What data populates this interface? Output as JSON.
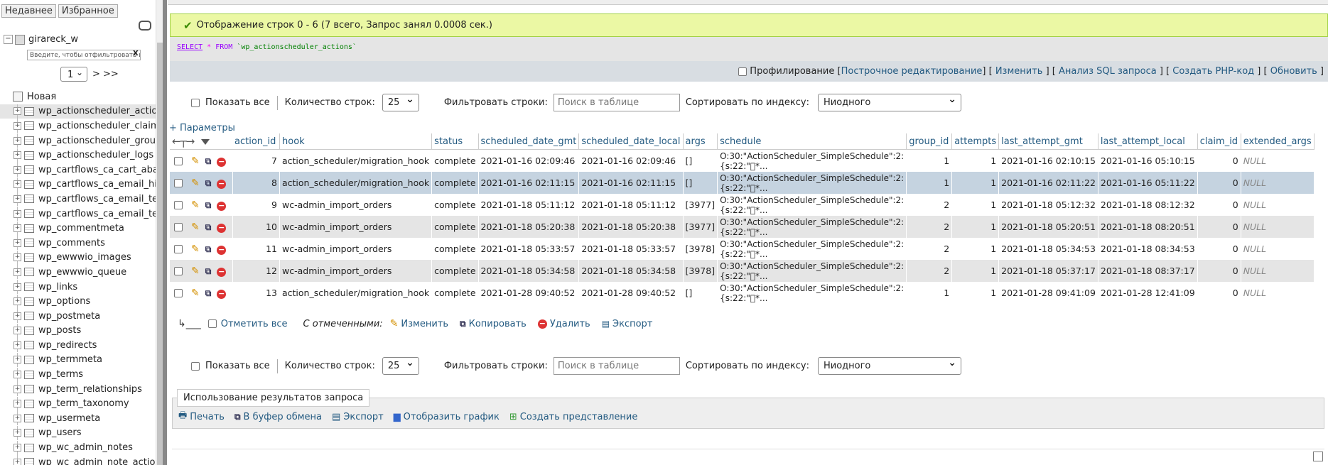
{
  "nav": {
    "tabs": [
      "Недавнее",
      "Избранное"
    ],
    "db_name": "girareck_w",
    "filter_placeholder": "Введите, чтобы отфильтровать и",
    "filter_clear": "X",
    "page": "1",
    "page_next": "> >>",
    "new_label": "Новая",
    "tables": [
      "wp_actionscheduler_actions",
      "wp_actionscheduler_claims",
      "wp_actionscheduler_groups",
      "wp_actionscheduler_logs",
      "wp_cartflows_ca_cart_abandonment",
      "wp_cartflows_ca_email_history",
      "wp_cartflows_ca_email_templates",
      "wp_cartflows_ca_email_templates_meta",
      "wp_commentmeta",
      "wp_comments",
      "wp_ewwwio_images",
      "wp_ewwwio_queue",
      "wp_links",
      "wp_options",
      "wp_postmeta",
      "wp_posts",
      "wp_redirects",
      "wp_termmeta",
      "wp_terms",
      "wp_term_relationships",
      "wp_term_taxonomy",
      "wp_usermeta",
      "wp_users",
      "wp_wc_admin_notes",
      "wp_wc_admin_note_actions"
    ]
  },
  "result": {
    "message": "Отображение строк 0 - 6 (7 всего, Запрос занял 0.0008 сек.)",
    "sql": {
      "select": "SELECT",
      "star": "*",
      "from": "FROM",
      "table": "`wp_actionscheduler_actions`"
    }
  },
  "links": {
    "profiling": "Профилирование",
    "inline_edit": "Построчное редактирование",
    "edit": "Изменить",
    "explain": "Анализ SQL запроса",
    "php": "Создать PHP-код",
    "refresh": "Обновить"
  },
  "controls": {
    "show_all": "Показать все",
    "row_count_label": "Количество строк:",
    "row_count": "25",
    "filter_label": "Фильтровать строки:",
    "filter_placeholder": "Поиск в таблице",
    "sort_label": "Сортировать по индексу:",
    "sort_value": "Ниодного"
  },
  "params_label": "+ Параметры",
  "table": {
    "columns": [
      "action_id",
      "hook",
      "status",
      "scheduled_date_gmt",
      "scheduled_date_local",
      "args",
      "schedule",
      "group_id",
      "attempts",
      "last_attempt_gmt",
      "last_attempt_local",
      "claim_id",
      "extended_args"
    ],
    "rows": [
      [
        "7",
        "action_scheduler/migration_hook",
        "complete",
        "2021-01-16 02:09:46",
        "2021-01-16 02:09:46",
        "[]",
        "O:30:\"ActionScheduler_SimpleSchedule\":2:{s:22:\"\u0000*...",
        "1",
        "1",
        "2021-01-16 02:10:15",
        "2021-01-16 05:10:15",
        "0",
        "NULL"
      ],
      [
        "8",
        "action_scheduler/migration_hook",
        "complete",
        "2021-01-16 02:11:15",
        "2021-01-16 02:11:15",
        "[]",
        "O:30:\"ActionScheduler_SimpleSchedule\":2:{s:22:\"\u0000*...",
        "1",
        "1",
        "2021-01-16 02:11:22",
        "2021-01-16 05:11:22",
        "0",
        "NULL"
      ],
      [
        "9",
        "wc-admin_import_orders",
        "complete",
        "2021-01-18 05:11:12",
        "2021-01-18 05:11:12",
        "[3977]",
        "O:30:\"ActionScheduler_SimpleSchedule\":2:{s:22:\"\u0000*...",
        "2",
        "1",
        "2021-01-18 05:12:32",
        "2021-01-18 08:12:32",
        "0",
        "NULL"
      ],
      [
        "10",
        "wc-admin_import_orders",
        "complete",
        "2021-01-18 05:20:38",
        "2021-01-18 05:20:38",
        "[3977]",
        "O:30:\"ActionScheduler_SimpleSchedule\":2:{s:22:\"\u0000*...",
        "2",
        "1",
        "2021-01-18 05:20:51",
        "2021-01-18 08:20:51",
        "0",
        "NULL"
      ],
      [
        "11",
        "wc-admin_import_orders",
        "complete",
        "2021-01-18 05:33:57",
        "2021-01-18 05:33:57",
        "[3978]",
        "O:30:\"ActionScheduler_SimpleSchedule\":2:{s:22:\"\u0000*...",
        "2",
        "1",
        "2021-01-18 05:34:53",
        "2021-01-18 08:34:53",
        "0",
        "NULL"
      ],
      [
        "12",
        "wc-admin_import_orders",
        "complete",
        "2021-01-18 05:34:58",
        "2021-01-18 05:34:58",
        "[3978]",
        "O:30:\"ActionScheduler_SimpleSchedule\":2:{s:22:\"\u0000*...",
        "2",
        "1",
        "2021-01-18 05:37:17",
        "2021-01-18 08:37:17",
        "0",
        "NULL"
      ],
      [
        "13",
        "action_scheduler/migration_hook",
        "complete",
        "2021-01-28 09:40:52",
        "2021-01-28 09:40:52",
        "[]",
        "O:30:\"ActionScheduler_SimpleSchedule\":2:{s:22:\"\u0000*...",
        "1",
        "1",
        "2021-01-28 09:41:09",
        "2021-01-28 12:41:09",
        "0",
        "NULL"
      ]
    ]
  },
  "with_selected": {
    "check_all": "Отметить все",
    "label": "С отмеченными:",
    "edit": "Изменить",
    "copy": "Копировать",
    "delete": "Удалить",
    "export": "Экспорт"
  },
  "query_ops": {
    "legend": "Использование результатов запроса",
    "print": "Печать",
    "clipboard": "В буфер обмена",
    "export": "Экспорт",
    "chart": "Отобразить график",
    "view": "Создать представление"
  }
}
